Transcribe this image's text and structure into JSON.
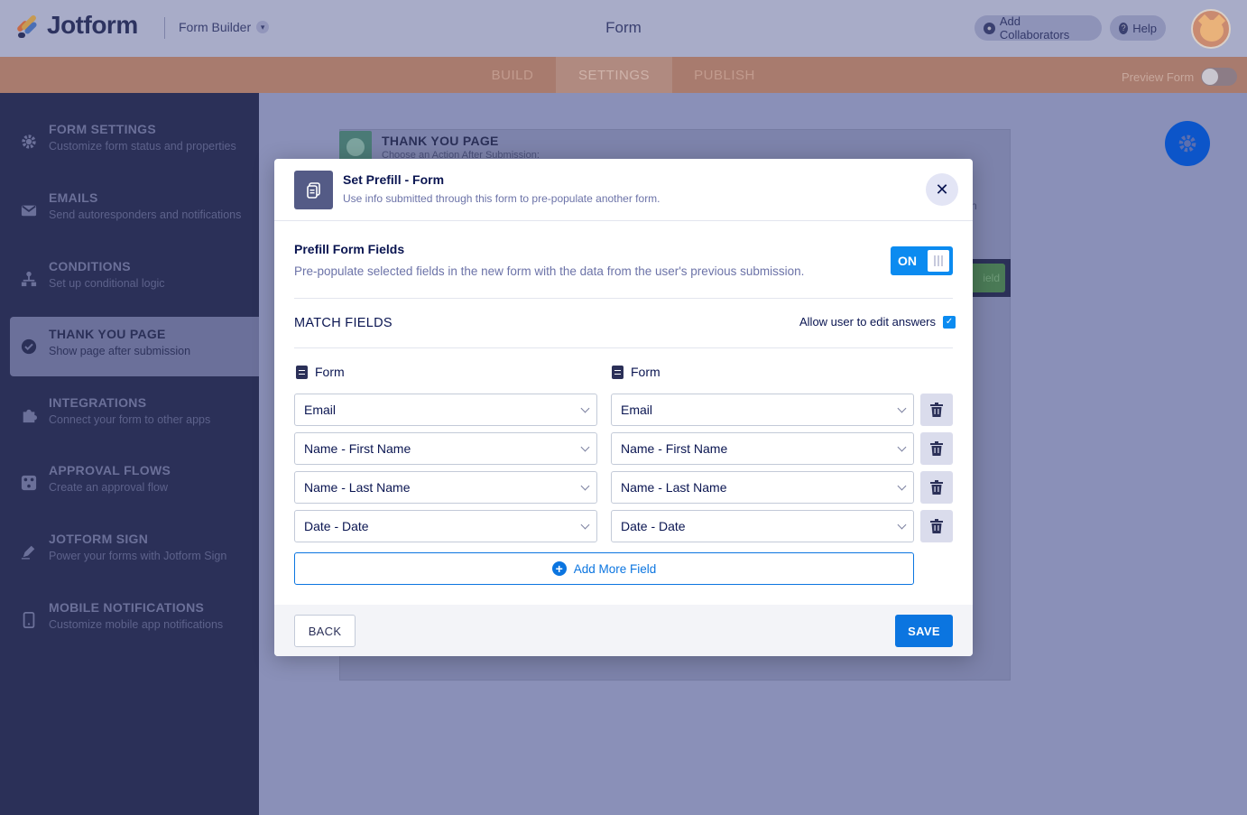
{
  "header": {
    "logo_text": "Jotform",
    "builder_label": "Form Builder",
    "form_title": "Form",
    "add_collaborators": "Add Collaborators",
    "help": "Help"
  },
  "tabs": [
    {
      "label": "BUILD"
    },
    {
      "label": "SETTINGS",
      "active": true
    },
    {
      "label": "PUBLISH"
    }
  ],
  "preview_form_label": "Preview Form",
  "sidebar": {
    "items": [
      {
        "title": "FORM SETTINGS",
        "subtitle": "Customize form status and properties",
        "icon": "gear-icon"
      },
      {
        "title": "EMAILS",
        "subtitle": "Send autoresponders and notifications",
        "icon": "envelope-icon"
      },
      {
        "title": "CONDITIONS",
        "subtitle": "Set up conditional logic",
        "icon": "conditions-icon"
      },
      {
        "title": "THANK YOU PAGE",
        "subtitle": "Show page after submission",
        "icon": "check-circle-icon",
        "active": true
      },
      {
        "title": "INTEGRATIONS",
        "subtitle": "Connect your form to other apps",
        "icon": "puzzle-icon"
      },
      {
        "title": "APPROVAL FLOWS",
        "subtitle": "Create an approval flow",
        "icon": "approval-icon"
      },
      {
        "title": "JOTFORM SIGN",
        "subtitle": "Power your forms with Jotform Sign",
        "icon": "pen-icon"
      },
      {
        "title": "MOBILE NOTIFICATIONS",
        "subtitle": "Customize mobile app notifications",
        "icon": "mobile-icon"
      }
    ]
  },
  "background": {
    "thank_you_title": "THANK YOU PAGE",
    "thank_you_sub": "Choose an Action After Submission:",
    "fragment_text": "n",
    "green_button_text": "ield"
  },
  "modal": {
    "title": "Set Prefill - Form",
    "subtitle": "Use info submitted through this form to pre-populate another form.",
    "prefill_title": "Prefill Form Fields",
    "prefill_sub": "Pre-populate selected fields in the new form with the data from the user's previous submission.",
    "toggle_label": "ON",
    "match_fields_title": "MATCH FIELDS",
    "allow_edit_label": "Allow user to edit answers",
    "left_column_label": "Form",
    "right_column_label": "Form",
    "rows": [
      {
        "left": "Email",
        "right": "Email"
      },
      {
        "left": "Name - First Name",
        "right": "Name - First Name"
      },
      {
        "left": "Name - Last Name",
        "right": "Name - Last Name"
      },
      {
        "left": "Date - Date",
        "right": "Date - Date"
      }
    ],
    "add_more_label": "Add More Field",
    "back_label": "BACK",
    "save_label": "SAVE"
  },
  "colors": {
    "accent": "#0B75E0",
    "toggle_on": "#0B8BF0",
    "sidebar_bg": "#2B3058",
    "text_dark": "#0A1551"
  }
}
